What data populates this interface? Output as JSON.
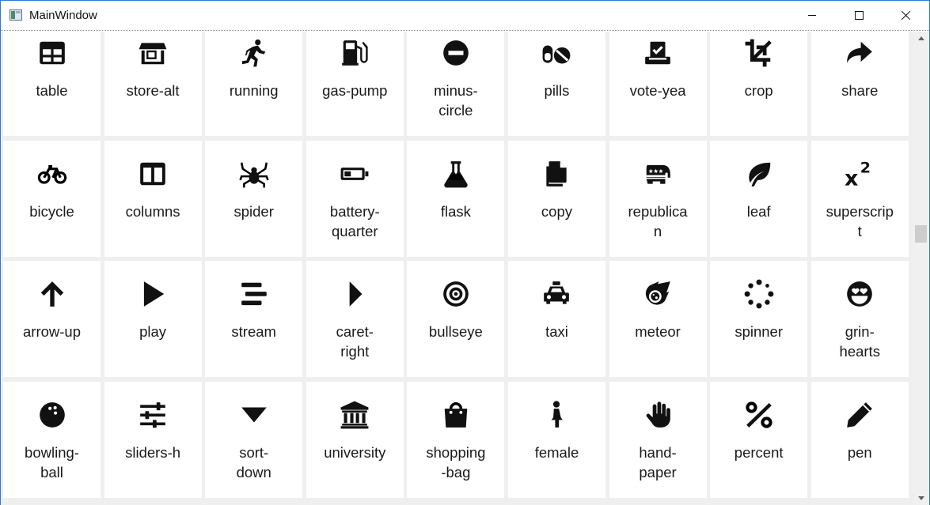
{
  "window": {
    "title": "MainWindow",
    "minimize_icon": "minimize-icon",
    "maximize_icon": "maximize-icon",
    "close_icon": "close-icon"
  },
  "icons": [
    {
      "name": "table"
    },
    {
      "name": "store-alt"
    },
    {
      "name": "running"
    },
    {
      "name": "gas-pump"
    },
    {
      "name": "minus-circle",
      "label": "minus-\ncircle"
    },
    {
      "name": "pills"
    },
    {
      "name": "vote-yea"
    },
    {
      "name": "crop"
    },
    {
      "name": "share"
    },
    {
      "name": "bicycle"
    },
    {
      "name": "columns"
    },
    {
      "name": "spider"
    },
    {
      "name": "battery-quarter",
      "label": "battery-\nquarter"
    },
    {
      "name": "flask"
    },
    {
      "name": "copy"
    },
    {
      "name": "republican",
      "label": "republica\nn"
    },
    {
      "name": "leaf"
    },
    {
      "name": "superscript",
      "label": "superscrip\nt"
    },
    {
      "name": "arrow-up"
    },
    {
      "name": "play"
    },
    {
      "name": "stream"
    },
    {
      "name": "caret-right",
      "label": "caret-\nright"
    },
    {
      "name": "bullseye"
    },
    {
      "name": "taxi"
    },
    {
      "name": "meteor"
    },
    {
      "name": "spinner"
    },
    {
      "name": "grin-hearts",
      "label": "grin-\nhearts"
    },
    {
      "name": "bowling-ball",
      "label": "bowling-\nball"
    },
    {
      "name": "sliders-h"
    },
    {
      "name": "sort-down",
      "label": "sort-\ndown"
    },
    {
      "name": "university"
    },
    {
      "name": "shopping-bag",
      "label": "shopping\n-bag"
    },
    {
      "name": "female"
    },
    {
      "name": "hand-paper",
      "label": "hand-\npaper"
    },
    {
      "name": "percent"
    },
    {
      "name": "pen"
    }
  ],
  "colors": {
    "window_border": "#2b79d6",
    "tile_bg": "#ffffff",
    "gap_bg": "#efefef",
    "icon": "#111111"
  }
}
